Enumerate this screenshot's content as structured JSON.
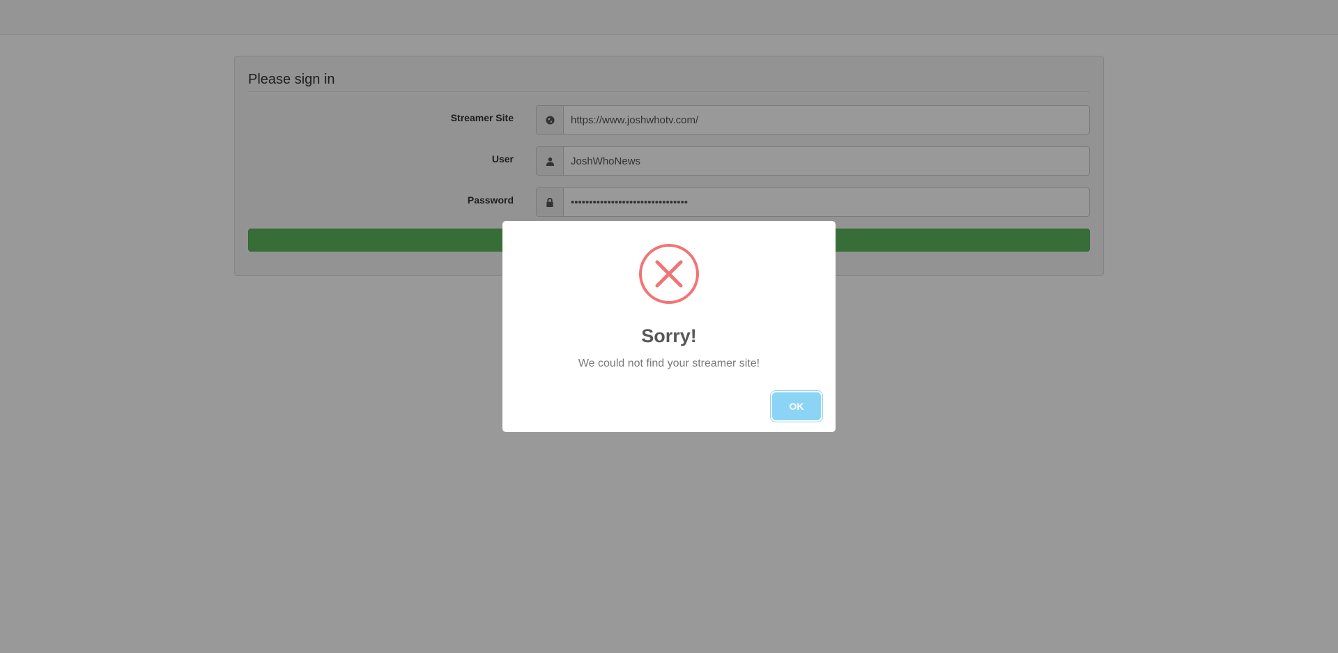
{
  "form": {
    "title": "Please sign in",
    "fields": [
      {
        "label": "Streamer Site",
        "value": "https://www.joshwhotv.com/",
        "icon": "globe-icon"
      },
      {
        "label": "User",
        "value": "JoshWhoNews",
        "icon": "user-icon"
      },
      {
        "label": "Password",
        "value": "••••••••••••••••••••••••••••••••",
        "icon": "lock-icon"
      }
    ],
    "submit_color": "#5cb85c"
  },
  "modal": {
    "icon": "error-x-icon",
    "title": "Sorry!",
    "message": "We could not find your streamer site!",
    "ok_label": "OK",
    "accent_color": "#f27474",
    "button_color": "#8cd4f5"
  }
}
